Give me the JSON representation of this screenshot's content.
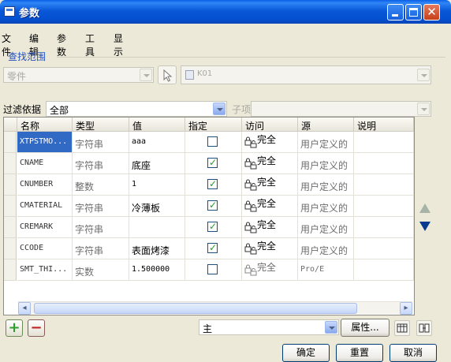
{
  "window": {
    "title": "参数"
  },
  "menu": [
    "文件",
    "编辑",
    "参数",
    "工具",
    "显示"
  ],
  "search": {
    "group_label": "查找范围",
    "scope_value": "零件",
    "model_value": "K01"
  },
  "filter": {
    "label": "过滤依据",
    "value": "全部",
    "subitem_label": "子项"
  },
  "table": {
    "columns": [
      "名称",
      "类型",
      "值",
      "指定",
      "访问",
      "源",
      "说明"
    ],
    "rows": [
      {
        "name": "XTPSTMO...",
        "type": "字符串",
        "value": "aaa",
        "designated": false,
        "access": "完全",
        "source": "用户定义的",
        "note": ""
      },
      {
        "name": "CNAME",
        "type": "字符串",
        "value": "底座",
        "designated": true,
        "access": "完全",
        "source": "用户定义的",
        "note": ""
      },
      {
        "name": "CNUMBER",
        "type": "整数",
        "value": "1",
        "designated": true,
        "access": "完全",
        "source": "用户定义的",
        "note": ""
      },
      {
        "name": "CMATERIAL",
        "type": "字符串",
        "value": "冷薄板",
        "designated": true,
        "access": "完全",
        "source": "用户定义的",
        "note": ""
      },
      {
        "name": "CREMARK",
        "type": "字符串",
        "value": "",
        "designated": true,
        "access": "完全",
        "source": "用户定义的",
        "note": ""
      },
      {
        "name": "CCODE",
        "type": "字符串",
        "value": "表面烤漆",
        "designated": true,
        "access": "完全",
        "source": "用户定义的",
        "note": ""
      },
      {
        "name": "SMT_THI...",
        "type": "实数",
        "value": "1.500000",
        "designated": false,
        "access": "完全",
        "source": "Pro/E",
        "note": ""
      }
    ]
  },
  "bottom": {
    "view_value": "主",
    "properties_button": "属性...",
    "ok_button": "确定",
    "reset_button": "重置",
    "cancel_button": "取消"
  },
  "colors": {
    "titlebar": "#0a58d8",
    "selection": "#316ac5",
    "add_green": "#2aa02a",
    "remove_red": "#c22020"
  }
}
